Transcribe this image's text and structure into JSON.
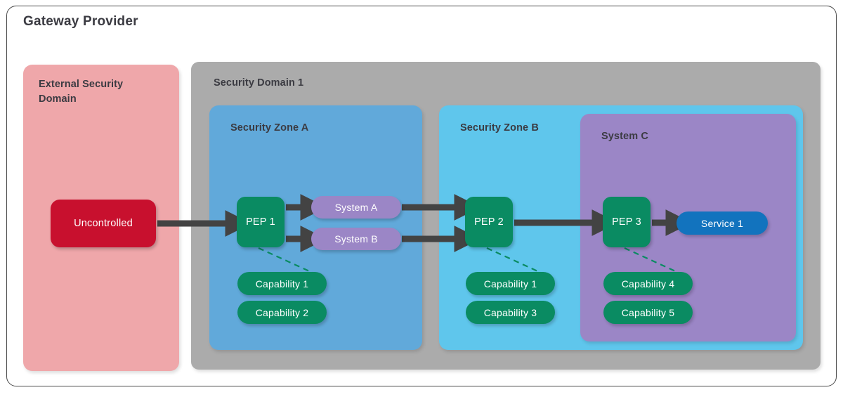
{
  "frame": {
    "title": "Gateway Provider",
    "border_color": "#4a4a4a"
  },
  "regions": {
    "external_security_domain": {
      "label": "External Security\nDomain",
      "label_line1": "External Security",
      "label_line2": "Domain",
      "color": "#EFA7AA"
    },
    "security_domain_1": {
      "label": "Security Domain 1",
      "color": "#ABABAB"
    },
    "security_zone_a": {
      "label": "Security Zone A",
      "color": "#61A9DA"
    },
    "security_zone_b": {
      "label": "Security Zone B",
      "color": "#5FC6EC"
    },
    "system_c": {
      "label": "System C",
      "color": "#9B86C6"
    }
  },
  "nodes": {
    "uncontrolled": {
      "label": "Uncontrolled",
      "color": "#C8102E"
    },
    "pep1": {
      "label": "PEP 1",
      "color": "#0A8B62"
    },
    "pep2": {
      "label": "PEP 2",
      "color": "#0A8B62"
    },
    "pep3": {
      "label": "PEP 3",
      "color": "#0A8B62"
    },
    "system_a": {
      "label": "System A",
      "color": "#9B86C6"
    },
    "system_b": {
      "label": "System B",
      "color": "#9B86C6"
    },
    "service1": {
      "label": "Service 1",
      "color": "#1273BE"
    }
  },
  "capabilities": {
    "zone_a": [
      {
        "label": "Capability 1",
        "color": "#0A8B62"
      },
      {
        "label": "Capability 2",
        "color": "#0A8B62"
      }
    ],
    "zone_b": [
      {
        "label": "Capability 1",
        "color": "#0A8B62"
      },
      {
        "label": "Capability 3",
        "color": "#0A8B62"
      }
    ],
    "system_c": [
      {
        "label": "Capability 4",
        "color": "#0A8B62"
      },
      {
        "label": "Capability 5",
        "color": "#0A8B62"
      }
    ]
  },
  "connectors": {
    "arrow_color": "#434343",
    "dashed_color": "#0A8B62",
    "flows": [
      "Uncontrolled -> PEP 1",
      "PEP 1 -> System A",
      "PEP 1 -> System B",
      "System A -> PEP 2",
      "System B -> PEP 2",
      "PEP 2 -> PEP 3",
      "PEP 3 -> Service 1"
    ],
    "associations": [
      "PEP 1 -- Capability 1",
      "PEP 2 -- Capability 1",
      "PEP 3 -- Capability 4"
    ]
  }
}
